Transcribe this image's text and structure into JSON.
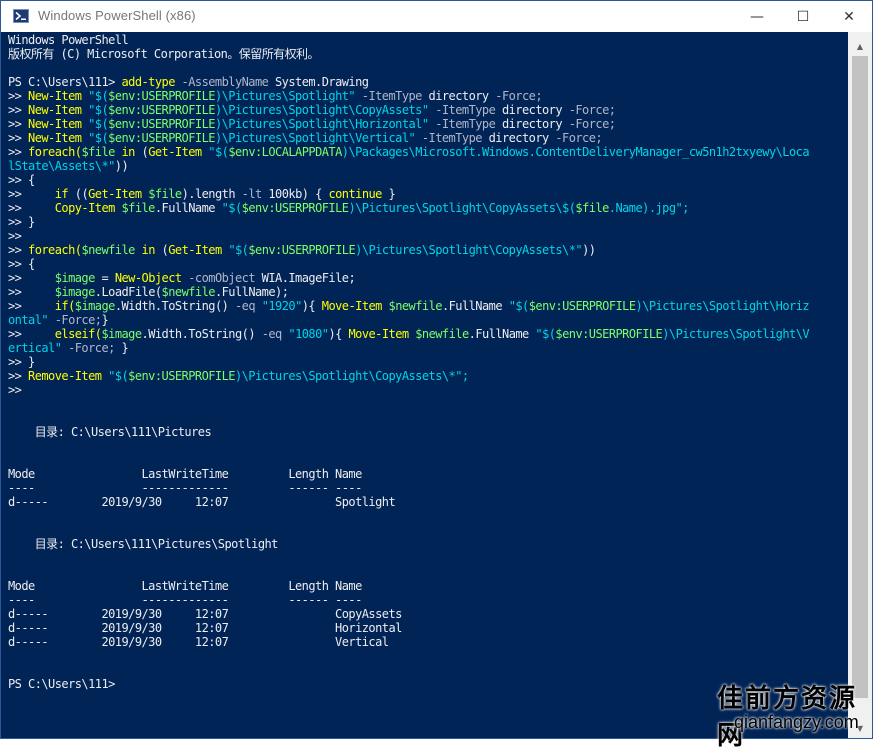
{
  "window": {
    "title": "Windows PowerShell (x86)",
    "minimize": "—",
    "maximize": "☐",
    "close": "✕"
  },
  "colors": {
    "background": "#012456",
    "text": "#eeedf0",
    "keyword": "#ffff00",
    "string": "#00d5e8",
    "variable": "#7cff6b",
    "parameter": "#b0b6c8"
  },
  "console": {
    "lines": [
      [
        {
          "t": "Windows PowerShell",
          "c": ""
        }
      ],
      [
        {
          "t": "版权所有 (C) Microsoft Corporation。保留所有权利。",
          "c": ""
        }
      ],
      [],
      [
        {
          "t": "PS C:\\Users\\111> ",
          "c": ""
        },
        {
          "t": "add-type",
          "c": "yel"
        },
        {
          "t": " -AssemblyName",
          "c": "gry"
        },
        {
          "t": " System.Drawing",
          "c": ""
        }
      ],
      [
        {
          "t": ">> ",
          "c": ""
        },
        {
          "t": "New-Item",
          "c": "yel"
        },
        {
          "t": " \"$(",
          "c": "str"
        },
        {
          "t": "$env:USERPROFILE",
          "c": "var"
        },
        {
          "t": ")\\Pictures\\Spotlight\"",
          "c": "str"
        },
        {
          "t": " -ItemType",
          "c": "gry"
        },
        {
          "t": " directory",
          "c": ""
        },
        {
          "t": " -Force;",
          "c": "gry"
        }
      ],
      [
        {
          "t": ">> ",
          "c": ""
        },
        {
          "t": "New-Item",
          "c": "yel"
        },
        {
          "t": " \"$(",
          "c": "str"
        },
        {
          "t": "$env:USERPROFILE",
          "c": "var"
        },
        {
          "t": ")\\Pictures\\Spotlight\\CopyAssets\"",
          "c": "str"
        },
        {
          "t": " -ItemType",
          "c": "gry"
        },
        {
          "t": " directory",
          "c": ""
        },
        {
          "t": " -Force;",
          "c": "gry"
        }
      ],
      [
        {
          "t": ">> ",
          "c": ""
        },
        {
          "t": "New-Item",
          "c": "yel"
        },
        {
          "t": " \"$(",
          "c": "str"
        },
        {
          "t": "$env:USERPROFILE",
          "c": "var"
        },
        {
          "t": ")\\Pictures\\Spotlight\\Horizontal\"",
          "c": "str"
        },
        {
          "t": " -ItemType",
          "c": "gry"
        },
        {
          "t": " directory",
          "c": ""
        },
        {
          "t": " -Force;",
          "c": "gry"
        }
      ],
      [
        {
          "t": ">> ",
          "c": ""
        },
        {
          "t": "New-Item",
          "c": "yel"
        },
        {
          "t": " \"$(",
          "c": "str"
        },
        {
          "t": "$env:USERPROFILE",
          "c": "var"
        },
        {
          "t": ")\\Pictures\\Spotlight\\Vertical\"",
          "c": "str"
        },
        {
          "t": " -ItemType",
          "c": "gry"
        },
        {
          "t": " directory",
          "c": ""
        },
        {
          "t": " -Force;",
          "c": "gry"
        }
      ],
      [
        {
          "t": ">> ",
          "c": ""
        },
        {
          "t": "foreach(",
          "c": "yel"
        },
        {
          "t": "$file",
          "c": "var"
        },
        {
          "t": " in ",
          "c": "yel"
        },
        {
          "t": "(",
          "c": ""
        },
        {
          "t": "Get-Item",
          "c": "yel"
        },
        {
          "t": " \"$(",
          "c": "str"
        },
        {
          "t": "$env:LOCALAPPDATA",
          "c": "var"
        },
        {
          "t": ")\\Packages\\Microsoft.Windows.ContentDeliveryManager_cw5n1h2txyewy\\Loca",
          "c": "str"
        }
      ],
      [
        {
          "t": "lState\\Assets\\*\"",
          "c": "str"
        },
        {
          "t": "))",
          "c": ""
        }
      ],
      [
        {
          "t": ">> {",
          "c": ""
        }
      ],
      [
        {
          "t": ">>     ",
          "c": ""
        },
        {
          "t": "if",
          "c": "yel"
        },
        {
          "t": " ((",
          "c": ""
        },
        {
          "t": "Get-Item",
          "c": "yel"
        },
        {
          "t": " $file",
          "c": "var"
        },
        {
          "t": ").length ",
          "c": ""
        },
        {
          "t": "-lt",
          "c": "gry"
        },
        {
          "t": " 100kb) { ",
          "c": ""
        },
        {
          "t": "continue",
          "c": "yel"
        },
        {
          "t": " }",
          "c": ""
        }
      ],
      [
        {
          "t": ">>     ",
          "c": ""
        },
        {
          "t": "Copy-Item",
          "c": "yel"
        },
        {
          "t": " $file",
          "c": "var"
        },
        {
          "t": ".FullName ",
          "c": ""
        },
        {
          "t": "\"$(",
          "c": "str"
        },
        {
          "t": "$env:USERPROFILE",
          "c": "var"
        },
        {
          "t": ")\\Pictures\\Spotlight\\CopyAssets\\$(",
          "c": "str"
        },
        {
          "t": "$file",
          "c": "var"
        },
        {
          "t": ".Name).jpg\";",
          "c": "str"
        }
      ],
      [
        {
          "t": ">> }",
          "c": ""
        }
      ],
      [
        {
          "t": ">>",
          "c": ""
        }
      ],
      [
        {
          "t": ">> ",
          "c": ""
        },
        {
          "t": "foreach(",
          "c": "yel"
        },
        {
          "t": "$newfile",
          "c": "var"
        },
        {
          "t": " in ",
          "c": "yel"
        },
        {
          "t": "(",
          "c": ""
        },
        {
          "t": "Get-Item",
          "c": "yel"
        },
        {
          "t": " \"$(",
          "c": "str"
        },
        {
          "t": "$env:USERPROFILE",
          "c": "var"
        },
        {
          "t": ")\\Pictures\\Spotlight\\CopyAssets\\*\"",
          "c": "str"
        },
        {
          "t": "))",
          "c": ""
        }
      ],
      [
        {
          "t": ">> {",
          "c": ""
        }
      ],
      [
        {
          "t": ">>     ",
          "c": ""
        },
        {
          "t": "$image",
          "c": "var"
        },
        {
          "t": " = ",
          "c": ""
        },
        {
          "t": "New-Object",
          "c": "yel"
        },
        {
          "t": " -comObject",
          "c": "gry"
        },
        {
          "t": " WIA.ImageFile;",
          "c": ""
        }
      ],
      [
        {
          "t": ">>     ",
          "c": ""
        },
        {
          "t": "$image",
          "c": "var"
        },
        {
          "t": ".LoadFile(",
          "c": ""
        },
        {
          "t": "$newfile",
          "c": "var"
        },
        {
          "t": ".FullName);",
          "c": ""
        }
      ],
      [
        {
          "t": ">>     ",
          "c": ""
        },
        {
          "t": "if(",
          "c": "yel"
        },
        {
          "t": "$image",
          "c": "var"
        },
        {
          "t": ".Width.ToString() ",
          "c": ""
        },
        {
          "t": "-eq",
          "c": "gry"
        },
        {
          "t": " \"1920\"",
          "c": "str"
        },
        {
          "t": "){ ",
          "c": ""
        },
        {
          "t": "Move-Item",
          "c": "yel"
        },
        {
          "t": " $newfile",
          "c": "var"
        },
        {
          "t": ".FullName ",
          "c": ""
        },
        {
          "t": "\"$(",
          "c": "str"
        },
        {
          "t": "$env:USERPROFILE",
          "c": "var"
        },
        {
          "t": ")\\Pictures\\Spotlight\\Horiz",
          "c": "str"
        }
      ],
      [
        {
          "t": "ontal\"",
          "c": "str"
        },
        {
          "t": " -Force;",
          "c": "gry"
        },
        {
          "t": "}",
          "c": ""
        }
      ],
      [
        {
          "t": ">>     ",
          "c": ""
        },
        {
          "t": "elseif(",
          "c": "yel"
        },
        {
          "t": "$image",
          "c": "var"
        },
        {
          "t": ".Width.ToString() ",
          "c": ""
        },
        {
          "t": "-eq",
          "c": "gry"
        },
        {
          "t": " \"1080\"",
          "c": "str"
        },
        {
          "t": "){ ",
          "c": ""
        },
        {
          "t": "Move-Item",
          "c": "yel"
        },
        {
          "t": " $newfile",
          "c": "var"
        },
        {
          "t": ".FullName ",
          "c": ""
        },
        {
          "t": "\"$(",
          "c": "str"
        },
        {
          "t": "$env:USERPROFILE",
          "c": "var"
        },
        {
          "t": ")\\Pictures\\Spotlight\\V",
          "c": "str"
        }
      ],
      [
        {
          "t": "ertical\"",
          "c": "str"
        },
        {
          "t": " -Force;",
          "c": "gry"
        },
        {
          "t": " }",
          "c": ""
        }
      ],
      [
        {
          "t": ">> }",
          "c": ""
        }
      ],
      [
        {
          "t": ">> ",
          "c": ""
        },
        {
          "t": "Remove-Item",
          "c": "yel"
        },
        {
          "t": " \"$(",
          "c": "str"
        },
        {
          "t": "$env:USERPROFILE",
          "c": "var"
        },
        {
          "t": ")\\Pictures\\Spotlight\\CopyAssets\\*\";",
          "c": "str"
        }
      ],
      [
        {
          "t": ">>",
          "c": ""
        }
      ],
      [],
      [],
      [
        {
          "t": "    目录: C:\\Users\\111\\Pictures",
          "c": ""
        }
      ],
      [],
      [],
      [
        {
          "t": "Mode                LastWriteTime         Length Name",
          "c": ""
        }
      ],
      [
        {
          "t": "----                -------------         ------ ----",
          "c": ""
        }
      ],
      [
        {
          "t": "d-----        2019/9/30     12:07                Spotlight",
          "c": ""
        }
      ],
      [],
      [],
      [
        {
          "t": "    目录: C:\\Users\\111\\Pictures\\Spotlight",
          "c": ""
        }
      ],
      [],
      [],
      [
        {
          "t": "Mode                LastWriteTime         Length Name",
          "c": ""
        }
      ],
      [
        {
          "t": "----                -------------         ------ ----",
          "c": ""
        }
      ],
      [
        {
          "t": "d-----        2019/9/30     12:07                CopyAssets",
          "c": ""
        }
      ],
      [
        {
          "t": "d-----        2019/9/30     12:07                Horizontal",
          "c": ""
        }
      ],
      [
        {
          "t": "d-----        2019/9/30     12:07                Vertical",
          "c": ""
        }
      ],
      [],
      [],
      [
        {
          "t": "PS C:\\Users\\111>",
          "c": ""
        }
      ]
    ]
  },
  "watermark": {
    "cn": "佳前方资源网",
    "url": "qianfangzy.com"
  }
}
